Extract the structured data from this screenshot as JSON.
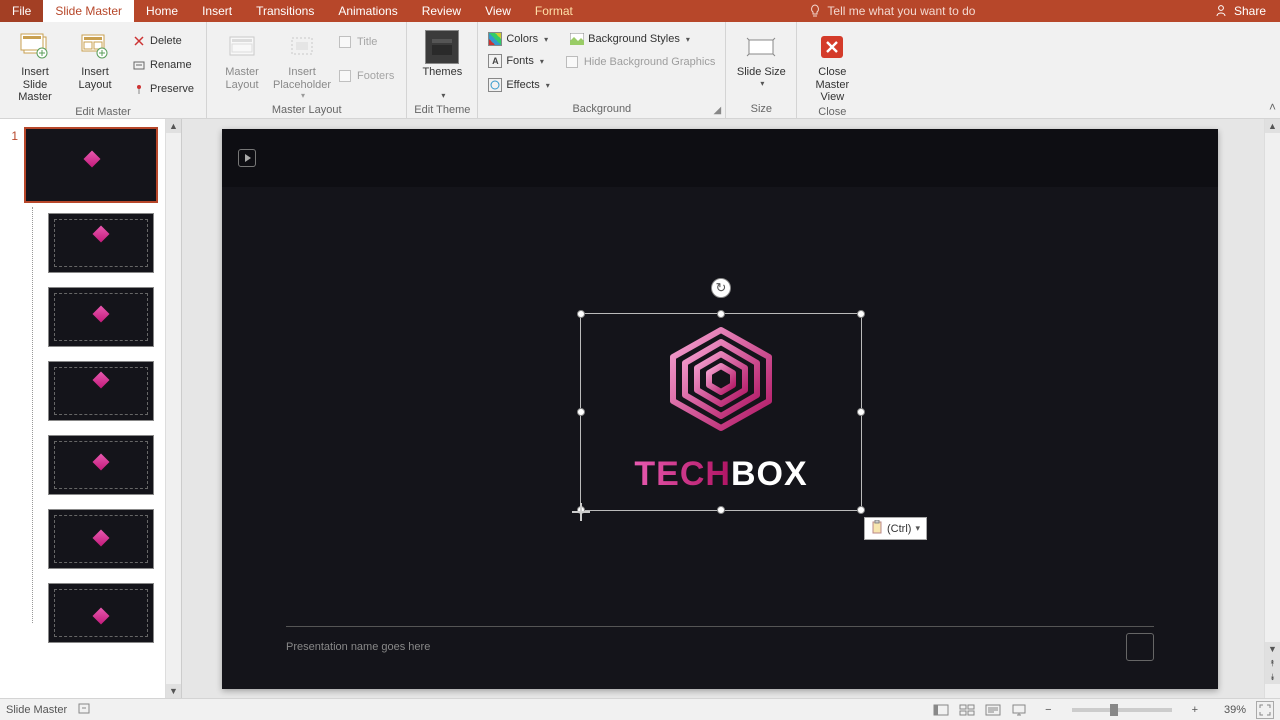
{
  "tabs": {
    "file": "File",
    "slideMaster": "Slide Master",
    "home": "Home",
    "insert": "Insert",
    "transitions": "Transitions",
    "animations": "Animations",
    "review": "Review",
    "view": "View",
    "format": "Format"
  },
  "tellMe": "Tell me what you want to do",
  "share": "Share",
  "ribbon": {
    "editMaster": {
      "insertSlideMaster": "Insert Slide Master",
      "insertLayout": "Insert Layout",
      "delete": "Delete",
      "rename": "Rename",
      "preserve": "Preserve",
      "label": "Edit Master"
    },
    "masterLayout": {
      "masterLayout": "Master Layout",
      "insertPlaceholder": "Insert Placeholder",
      "title": "Title",
      "footers": "Footers",
      "label": "Master Layout"
    },
    "editTheme": {
      "themes": "Themes",
      "label": "Edit Theme"
    },
    "background": {
      "colors": "Colors",
      "fonts": "Fonts",
      "effects": "Effects",
      "backgroundStyles": "Background Styles",
      "hideBg": "Hide Background Graphics",
      "label": "Background"
    },
    "size": {
      "slideSize": "Slide Size",
      "label": "Size"
    },
    "close": {
      "closeMaster": "Close Master View",
      "label": "Close"
    }
  },
  "thumbIndex": "1",
  "slide": {
    "logoPart1": "TECH",
    "logoPart2": "BOX",
    "footer": "Presentation name goes here"
  },
  "pasteTag": "(Ctrl)",
  "status": {
    "mode": "Slide Master",
    "zoom": "39%"
  }
}
